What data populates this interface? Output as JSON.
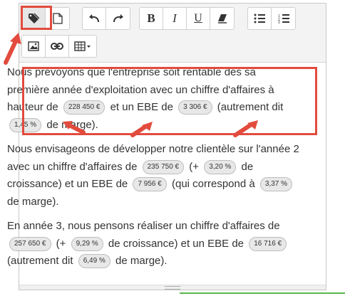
{
  "toolbar": {
    "row1": [
      {
        "name": "tag-icon",
        "glyph": "🏷",
        "active": true
      },
      {
        "name": "document-icon",
        "glyph": "🗋"
      },
      {
        "name": "undo-icon",
        "glyph": "↶"
      },
      {
        "name": "redo-icon",
        "glyph": "↷"
      },
      {
        "name": "bold-button",
        "glyph": "B"
      },
      {
        "name": "italic-button",
        "glyph": "I"
      },
      {
        "name": "underline-button",
        "glyph": "U"
      },
      {
        "name": "eraser-icon",
        "glyph": "⌫"
      },
      {
        "name": "bullet-list-icon",
        "glyph": "☰"
      },
      {
        "name": "numbered-list-icon",
        "glyph": "≡"
      }
    ],
    "row2": [
      {
        "name": "image-icon",
        "glyph": "▣"
      },
      {
        "name": "link-icon",
        "glyph": "⊂⊃"
      },
      {
        "name": "table-icon",
        "glyph": "▦▾"
      }
    ]
  },
  "paragraphs": {
    "p1": {
      "t1": "Nous prévoyons que l'entreprise soit rentable dés sa première année d'exploitation avec un chiffre d'affaires à hauteur de",
      "v1": "228 450 €",
      "t2": "et un EBE de",
      "v2": "3 306 €",
      "t3": "(autrement dit",
      "v3": "1,45 %",
      "t4": "de marge)."
    },
    "p2": {
      "t1": "Nous envisageons de développer notre clientèle sur l'année 2 avec un chiffre d'affaires de",
      "v1": "235 750 €",
      "t2": "(+",
      "v2": "3,20 %",
      "t3": "de croissance) et un EBE de",
      "v3": "7 956 €",
      "t4": "(qui correspond à",
      "v4": "3,37 %",
      "t5": "de marge)."
    },
    "p3": {
      "t1": "En année 3, nous pensons réaliser un chiffre d'affaires de",
      "v1": "257 650 €",
      "t2": "(+",
      "v2": "9,29 %",
      "t3": "de croissance) et un EBE de",
      "v3": "16 716 €",
      "t4": "(autrement dit",
      "v4": "6,49 %",
      "t5": "de marge)."
    }
  },
  "colors": {
    "highlight": "#e24b3d",
    "pill_bg": "#e8e8e8",
    "toolbar_bg": "#f3f3f3"
  }
}
